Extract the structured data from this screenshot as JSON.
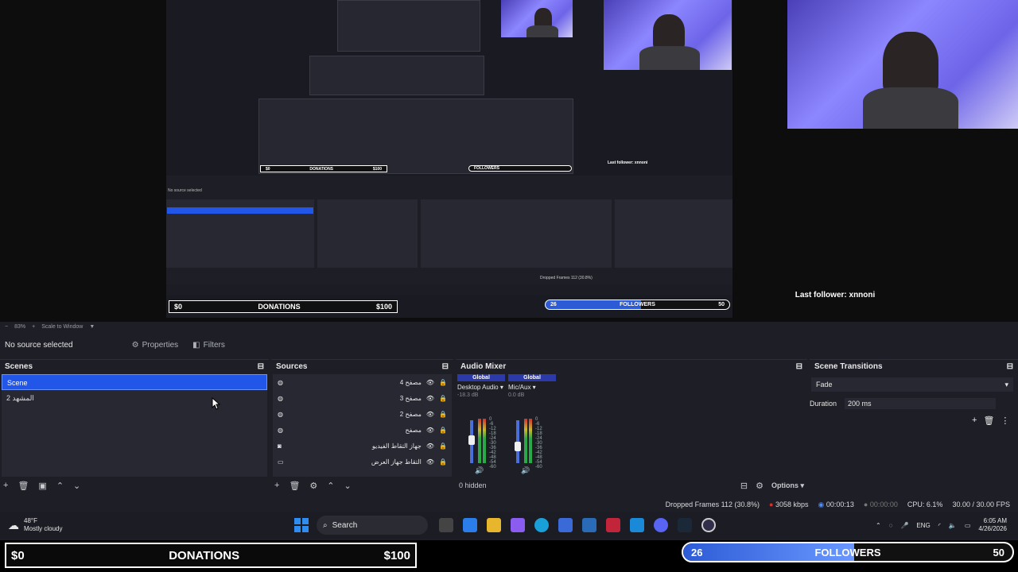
{
  "preview": {
    "mini_last_follower": "Last follower: xnnoni",
    "mini_no_source": "No source selected",
    "mini_donations": {
      "left": "$0",
      "center": "DONATIONS",
      "right": "$100"
    },
    "mini_followers": {
      "left": "26",
      "center": "FOLLOWERS",
      "right": "50"
    },
    "mini_dropped": "Dropped Frames 112 (30.8%)",
    "last_follower": "Last follower: xnnoni"
  },
  "zoom": {
    "percent": "83%",
    "mode": "Scale to Window"
  },
  "context": {
    "status": "No source selected",
    "properties_label": "Properties",
    "filters_label": "Filters"
  },
  "scenes": {
    "title": "Scenes",
    "items": [
      {
        "label": "Scene",
        "active": true
      },
      {
        "label": "المشهد 2",
        "active": false
      }
    ]
  },
  "sources": {
    "title": "Sources",
    "items": [
      {
        "label": "مصفح 4",
        "icon": "browser-icon"
      },
      {
        "label": "مصفح 3",
        "icon": "browser-icon"
      },
      {
        "label": "مصفح 2",
        "icon": "browser-icon"
      },
      {
        "label": "مصفح",
        "icon": "browser-icon"
      },
      {
        "label": "جهاز التقاط الفيديو",
        "icon": "camera-icon"
      },
      {
        "label": "التقاط جهاز العرض",
        "icon": "monitor-icon"
      }
    ]
  },
  "mixer": {
    "title": "Audio Mixer",
    "channels": [
      {
        "tag": "Global",
        "name": "Desktop Audio",
        "db": "-18.3 dB",
        "level": 0.55
      },
      {
        "tag": "Global",
        "name": "Mic/Aux",
        "db": "0.0 dB",
        "level": 0.35
      }
    ],
    "scale": [
      "0",
      "-6",
      "-12",
      "-18",
      "-24",
      "-30",
      "-36",
      "-42",
      "-48",
      "-54",
      "-60"
    ],
    "hidden_label": "0 hidden",
    "options_label": "Options"
  },
  "transitions": {
    "title": "Scene Transitions",
    "selected": "Fade",
    "duration_label": "Duration",
    "duration_value": "200 ms"
  },
  "status": {
    "dropped": "Dropped Frames 112 (30.8%)",
    "bitrate": "3058 kbps",
    "stream_time": "00:00:13",
    "rec_time": "00:00:00",
    "cpu": "CPU: 6.1%",
    "fps": "30.00 / 30.00 FPS"
  },
  "taskbar": {
    "weather_temp": "48°F",
    "weather_desc": "Mostly cloudy",
    "search_label": "Search",
    "lang": "ENG",
    "time": "6:05 AM",
    "date": "4/26/2026"
  },
  "overlay": {
    "donations_current": "$0",
    "donations_label": "DONATIONS",
    "donations_goal": "$100",
    "followers_current": "26",
    "followers_label": "FOLLOWERS",
    "followers_goal": "50",
    "followers_progress": 0.52
  },
  "colors": {
    "accent": "#2156e8",
    "brand_bar": "#2c39a8"
  }
}
